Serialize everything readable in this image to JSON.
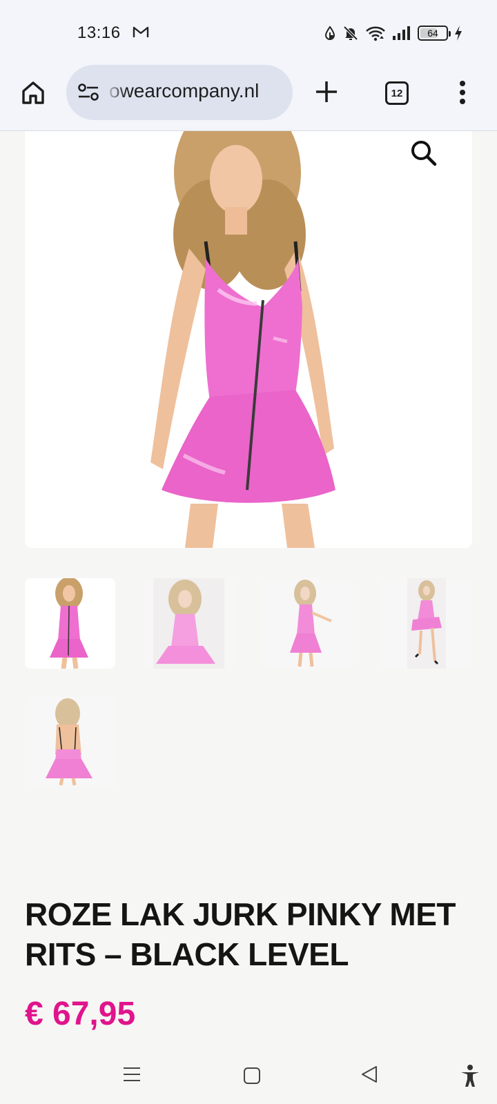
{
  "status_bar": {
    "time": "13:16",
    "battery": "64",
    "battery_level_percent": 64,
    "icons": [
      "gmail-icon",
      "data-saver-icon",
      "notifications-off-icon",
      "wifi-icon",
      "signal-icon",
      "battery-icon",
      "charging-icon"
    ]
  },
  "browser": {
    "url": "owearcompany.nl",
    "tab_count": "12",
    "icons": [
      "home-icon",
      "site-settings-icon",
      "new-tab-icon",
      "tab-switcher-icon",
      "more-menu-icon"
    ]
  },
  "product": {
    "title_line_1": "ROZE LAK JURK PINKY MET",
    "title_line_2": "RITS – BLACK LEVEL",
    "price": "€ 67,95",
    "images": {
      "main": "pink vinyl zip dress, front",
      "thumbnails": [
        "front",
        "front close",
        "side",
        "seated",
        "back"
      ]
    }
  },
  "colors": {
    "price_accent": "#e0148c",
    "dress_pink": "#ee6fd0",
    "toolbar_bg": "#f3f5fb",
    "page_bg": "#f6f6f4"
  },
  "nav_bar": {
    "icons": [
      "recents-icon",
      "home-square-icon",
      "back-triangle-icon",
      "accessibility-icon"
    ]
  }
}
